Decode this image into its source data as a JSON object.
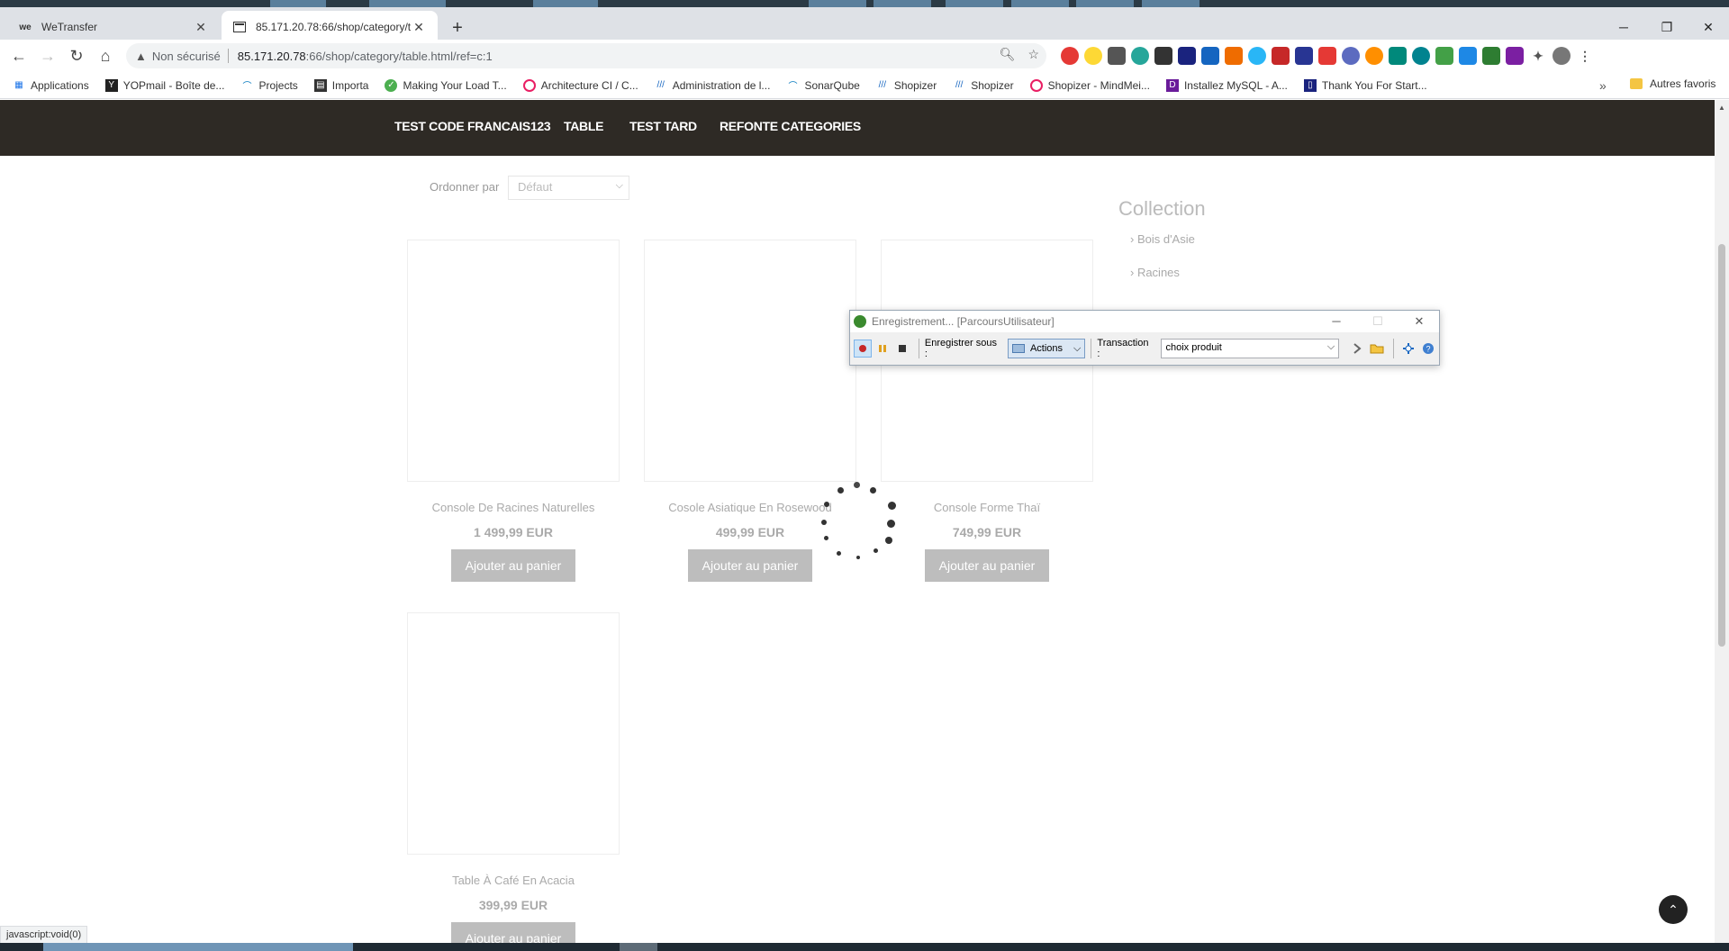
{
  "browser": {
    "tabs": [
      {
        "title": "WeTransfer",
        "favicon": "we-logo",
        "active": false
      },
      {
        "title": "85.171.20.78:66/shop/category/t",
        "favicon": "page-icon",
        "active": true
      }
    ],
    "new_tab_glyph": "+",
    "window_controls": {
      "minimize": "─",
      "restore": "❐",
      "close": "✕"
    },
    "address": {
      "security_label": "Non sécurisé",
      "host": "85.171.20.78",
      "path": ":66/shop/category/table.html/ref=c:1"
    },
    "bookmarks": [
      {
        "label": "Applications",
        "icon": "apps-grid-icon"
      },
      {
        "label": "YOPmail - Boîte de...",
        "icon": "yopmail-icon"
      },
      {
        "label": "Projects",
        "icon": "projects-icon"
      },
      {
        "label": "Importa",
        "icon": "importa-icon"
      },
      {
        "label": "Making Your Load T...",
        "icon": "green-logo-icon"
      },
      {
        "label": "Architecture CI / C...",
        "icon": "pink-logo-icon"
      },
      {
        "label": "Administration de l...",
        "icon": "shopizer-icon"
      },
      {
        "label": "SonarQube",
        "icon": "sonarqube-icon"
      },
      {
        "label": "Shopizer",
        "icon": "shopizer-icon"
      },
      {
        "label": "Shopizer",
        "icon": "shopizer-icon"
      },
      {
        "label": "Shopizer - MindMei...",
        "icon": "pink-logo-icon"
      },
      {
        "label": "Installez MySQL - A...",
        "icon": "openclassrooms-icon"
      },
      {
        "label": "Thank You For Start...",
        "icon": "doc-icon"
      }
    ],
    "bookmarks_overflow": "»",
    "other_bookmarks": "Autres favoris",
    "status_link": "javascript:void(0)"
  },
  "site": {
    "nav": [
      "TEST CODE FRANCAIS123",
      "TABLE",
      "TEST TARD",
      "REFONTE CATEGORIES"
    ],
    "sort": {
      "label": "Ordonner par",
      "value": "Défaut"
    },
    "products": [
      {
        "name": "Console De Racines Naturelles",
        "price": "1 499,99 EUR",
        "button": "Ajouter au panier"
      },
      {
        "name": "Cosole Asiatique En Rosewood",
        "price": "499,99 EUR",
        "button": "Ajouter au panier"
      },
      {
        "name": "Console Forme Thaï",
        "price": "749,99 EUR",
        "button": "Ajouter au panier"
      },
      {
        "name": "Table À Café En Acacia",
        "price": "399,99 EUR",
        "button": "Ajouter au panier"
      }
    ],
    "collection": {
      "title": "Collection",
      "items": [
        "› Bois d'Asie",
        "› Racines"
      ]
    }
  },
  "recorder": {
    "title": "Enregistrement... [ParcoursUtilisateur]",
    "save_as_label": "Enregistrer sous :",
    "save_as_value": "Actions",
    "transaction_label": "Transaction :",
    "transaction_value": "choix produit"
  },
  "colors": {
    "nav_bg": "#2e2a25",
    "button_bg": "#bdbdbd",
    "tab_bar": "#dee1e6"
  }
}
